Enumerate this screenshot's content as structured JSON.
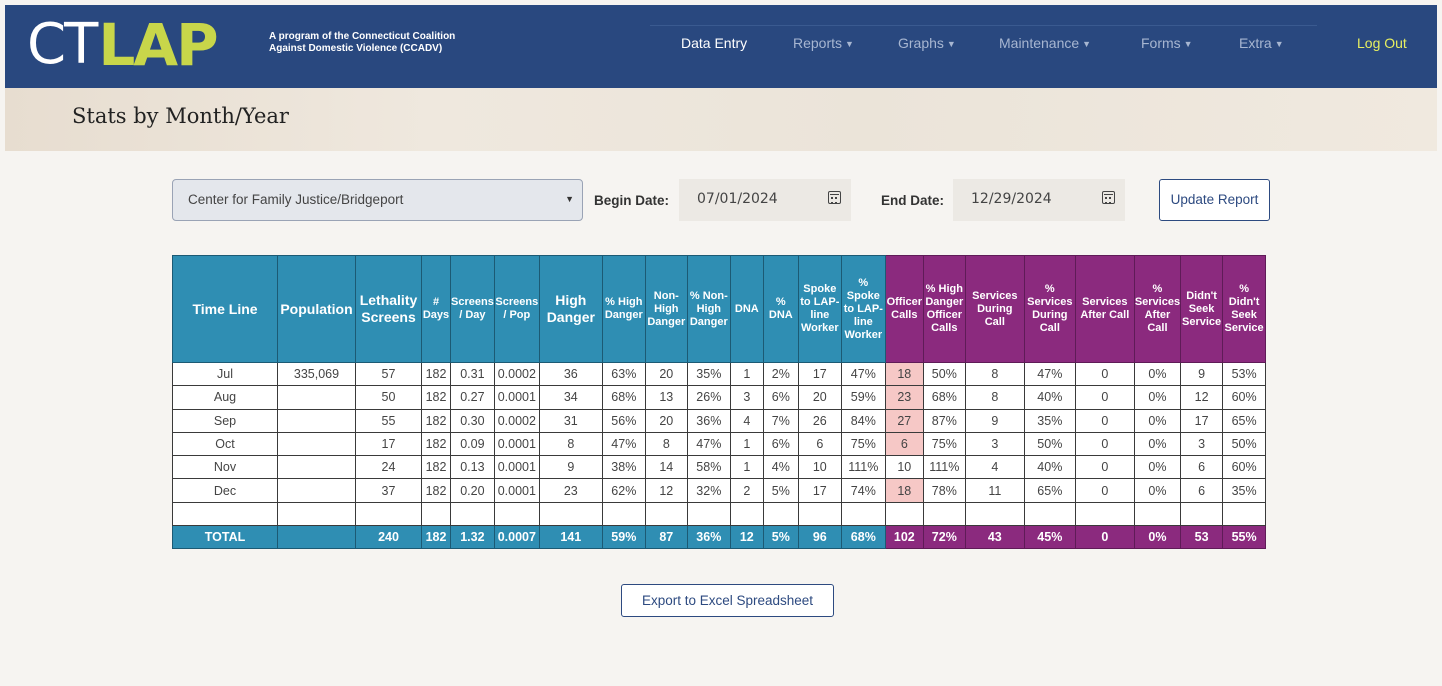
{
  "brand": {
    "logo_ct": "CT",
    "logo_lap": "LAP",
    "tagline_line1": "A program of the Connecticut Coalition",
    "tagline_line2": "Against Domestic Violence (CCADV)"
  },
  "nav": {
    "data_entry": "Data Entry",
    "reports": "Reports",
    "graphs": "Graphs",
    "maintenance": "Maintenance",
    "forms": "Forms",
    "extra": "Extra",
    "logout": "Log Out"
  },
  "page": {
    "title": "Stats by Month/Year"
  },
  "filters": {
    "agency": "Center for Family Justice/Bridgeport",
    "begin_label": "Begin Date:",
    "begin_value": "07/01/2024",
    "end_label": "End Date:",
    "end_value": "12/29/2024",
    "update_button": "Update Report"
  },
  "table": {
    "headers": [
      {
        "text": "Time Line",
        "group": "blue"
      },
      {
        "text": "Population",
        "group": "blue"
      },
      {
        "text": "Lethality Screens",
        "group": "blue"
      },
      {
        "text": "# Days",
        "group": "blue"
      },
      {
        "text": "Screens / Day",
        "group": "blue"
      },
      {
        "text": "Screens / Pop",
        "group": "blue"
      },
      {
        "text": "High Danger",
        "group": "blue"
      },
      {
        "text": "% High Danger",
        "group": "blue"
      },
      {
        "text": "Non-High Danger",
        "group": "blue"
      },
      {
        "text": "% Non-High Danger",
        "group": "blue"
      },
      {
        "text": "DNA",
        "group": "blue"
      },
      {
        "text": "% DNA",
        "group": "blue"
      },
      {
        "text": "Spoke to LAP-line Worker",
        "group": "blue"
      },
      {
        "text": "% Spoke to LAP-line Worker",
        "group": "blue"
      },
      {
        "text": "Officer Calls",
        "group": "purple"
      },
      {
        "text": "% High Danger Officer Calls",
        "group": "purple"
      },
      {
        "text": "Services During Call",
        "group": "purple"
      },
      {
        "text": "% Services During Call",
        "group": "purple"
      },
      {
        "text": "Services After Call",
        "group": "purple"
      },
      {
        "text": "% Services After Call",
        "group": "purple"
      },
      {
        "text": "Didn't Seek Service",
        "group": "purple"
      },
      {
        "text": "% Didn't Seek Service",
        "group": "purple"
      }
    ],
    "rows": [
      {
        "cells": [
          "Jul",
          "335,069",
          "57",
          "182",
          "0.31",
          "0.0002",
          "36",
          "63%",
          "20",
          "35%",
          "1",
          "2%",
          "17",
          "47%",
          "18",
          "50%",
          "8",
          "47%",
          "0",
          "0%",
          "9",
          "53%"
        ],
        "highlight_officer": true
      },
      {
        "cells": [
          "Aug",
          "",
          "50",
          "182",
          "0.27",
          "0.0001",
          "34",
          "68%",
          "13",
          "26%",
          "3",
          "6%",
          "20",
          "59%",
          "23",
          "68%",
          "8",
          "40%",
          "0",
          "0%",
          "12",
          "60%"
        ],
        "highlight_officer": true
      },
      {
        "cells": [
          "Sep",
          "",
          "55",
          "182",
          "0.30",
          "0.0002",
          "31",
          "56%",
          "20",
          "36%",
          "4",
          "7%",
          "26",
          "84%",
          "27",
          "87%",
          "9",
          "35%",
          "0",
          "0%",
          "17",
          "65%"
        ],
        "highlight_officer": true
      },
      {
        "cells": [
          "Oct",
          "",
          "17",
          "182",
          "0.09",
          "0.0001",
          "8",
          "47%",
          "8",
          "47%",
          "1",
          "6%",
          "6",
          "75%",
          "6",
          "75%",
          "3",
          "50%",
          "0",
          "0%",
          "3",
          "50%"
        ],
        "highlight_officer": true
      },
      {
        "cells": [
          "Nov",
          "",
          "24",
          "182",
          "0.13",
          "0.0001",
          "9",
          "38%",
          "14",
          "58%",
          "1",
          "4%",
          "10",
          "111%",
          "10",
          "111%",
          "4",
          "40%",
          "0",
          "0%",
          "6",
          "60%"
        ],
        "highlight_officer": false
      },
      {
        "cells": [
          "Dec",
          "",
          "37",
          "182",
          "0.20",
          "0.0001",
          "23",
          "62%",
          "12",
          "32%",
          "2",
          "5%",
          "17",
          "74%",
          "18",
          "78%",
          "11",
          "65%",
          "0",
          "0%",
          "6",
          "35%"
        ],
        "highlight_officer": true
      },
      {
        "cells": [
          "",
          "",
          "",
          "",
          "",
          "",
          "",
          "",
          "",
          "",
          "",
          "",
          "",
          "",
          "",
          "",
          "",
          "",
          "",
          "",
          "",
          ""
        ],
        "highlight_officer": false
      }
    ],
    "total": [
      "TOTAL",
      "",
      "240",
      "182",
      "1.32",
      "0.0007",
      "141",
      "59%",
      "87",
      "36%",
      "12",
      "5%",
      "96",
      "68%",
      "102",
      "72%",
      "43",
      "45%",
      "0",
      "0%",
      "53",
      "55%"
    ]
  },
  "export_button": "Export to Excel Spreadsheet",
  "colors": {
    "navbar": "#29487f",
    "logo_accent": "#c8d64a",
    "header_blue": "#2f8eb3",
    "header_purple": "#8b2a7e",
    "highlight_pink": "#f6c8c6"
  },
  "icons": {
    "dropdown": "chevron-down-icon",
    "date_picker": "calendar-icon",
    "menu_caret": "caret-down-icon"
  }
}
